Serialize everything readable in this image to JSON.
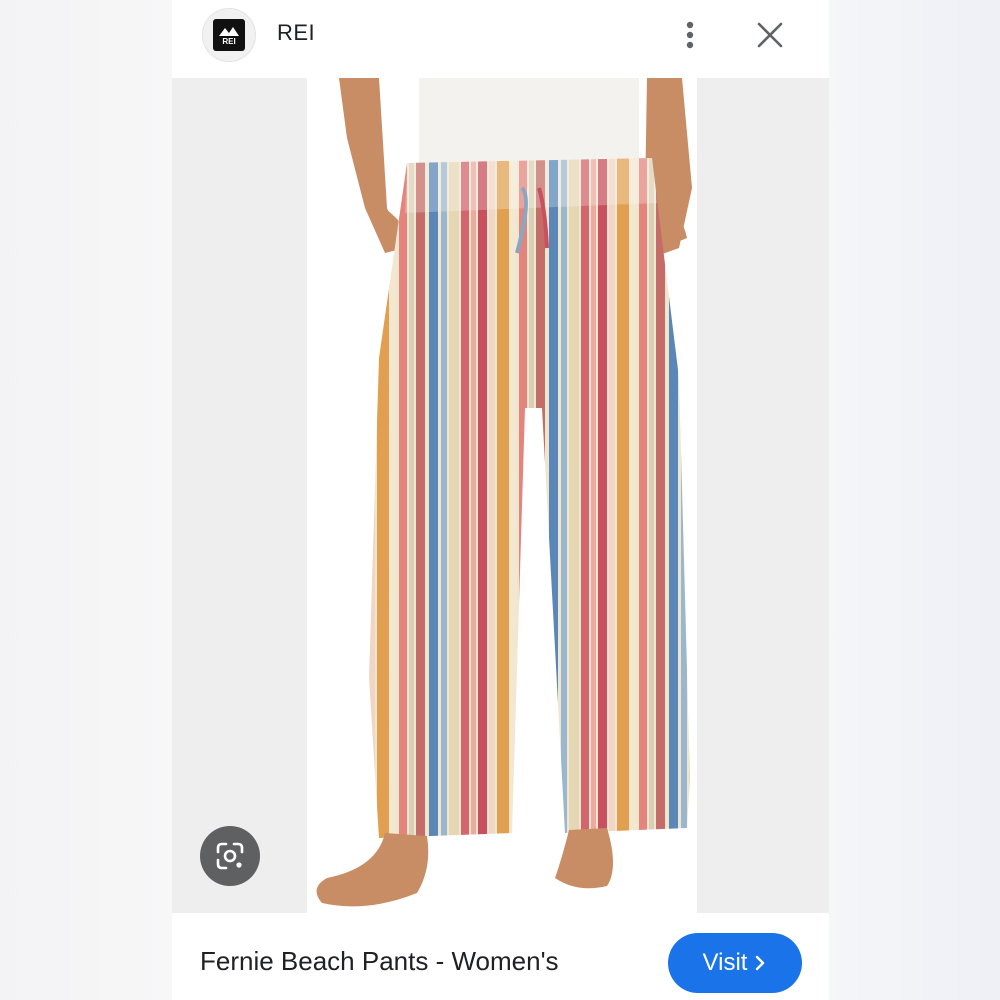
{
  "header": {
    "logo_text": "REI",
    "site_name": "REI",
    "more_icon": "more-vert-icon",
    "close_icon": "close-icon"
  },
  "image": {
    "lens_icon": "google-lens-icon"
  },
  "footer": {
    "title": "Fernie Beach Pants - Women's",
    "visit_label": "Visit",
    "visit_icon": "chevron-right-icon"
  },
  "colors": {
    "accent": "#1a73e8",
    "lens_button": "#5f6061"
  }
}
